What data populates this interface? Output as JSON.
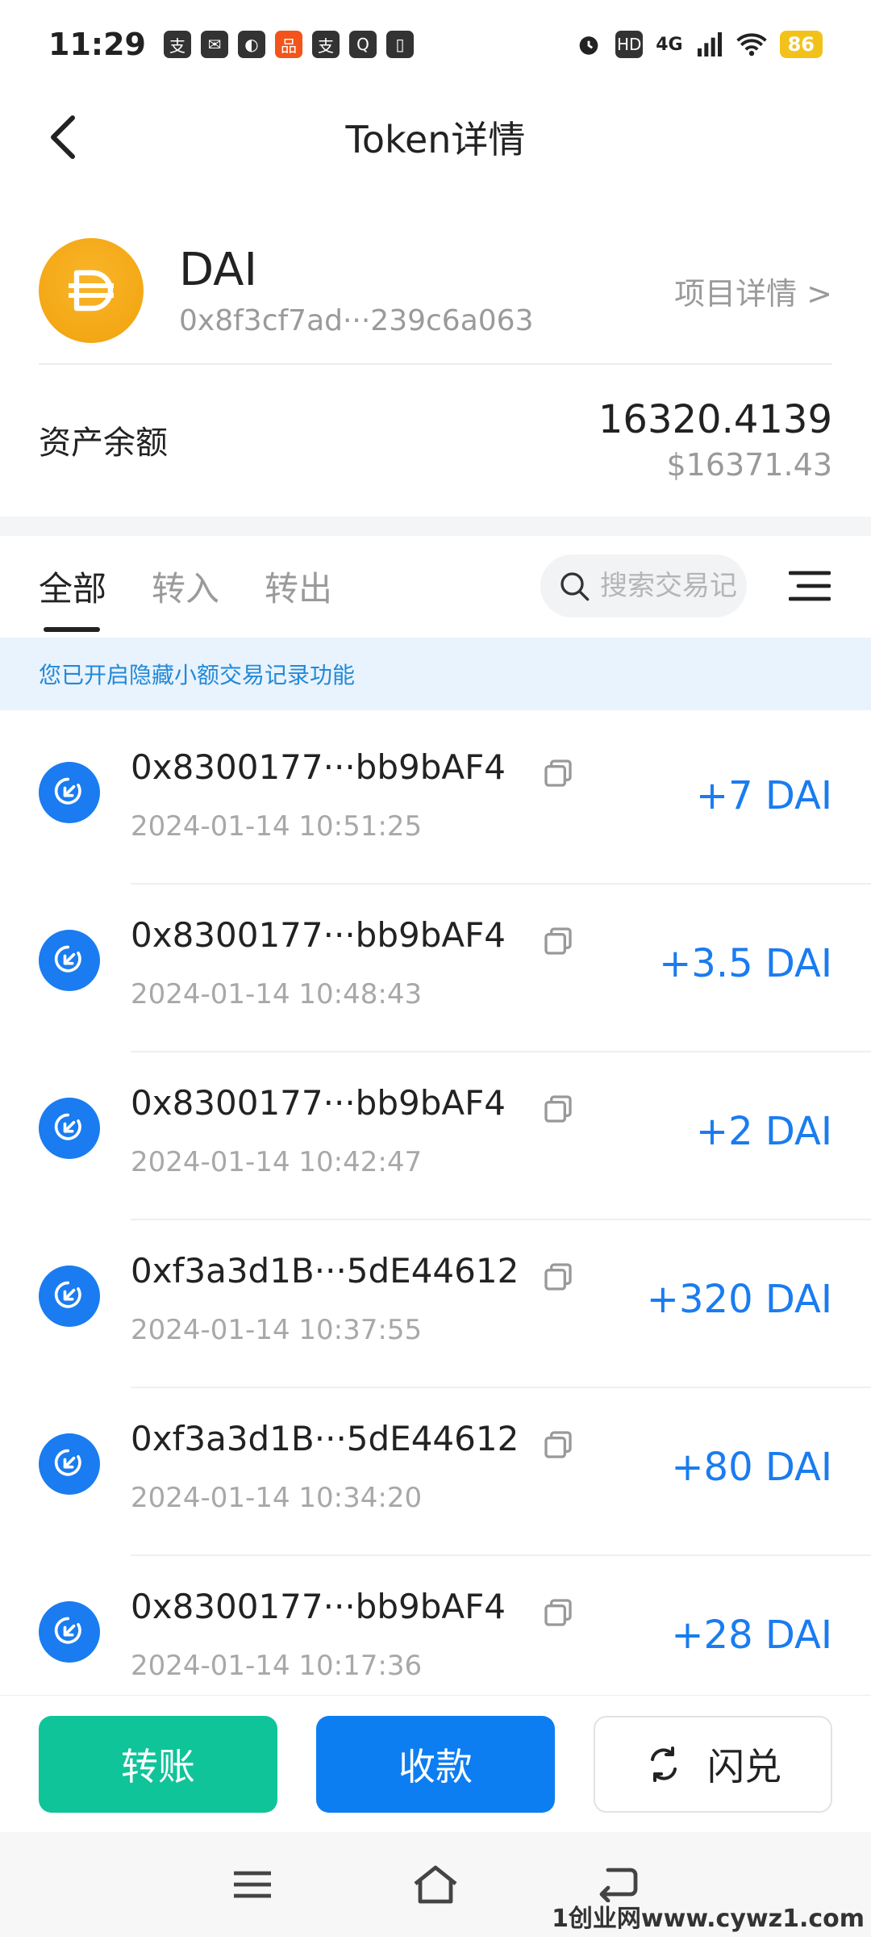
{
  "status_bar": {
    "time": "11:29",
    "network": "4G",
    "hd": "HD",
    "battery": "86"
  },
  "header": {
    "title": "Token详情"
  },
  "token": {
    "symbol": "DAI",
    "address": "0x8f3cf7ad···239c6a063",
    "project_link": "项目详情 >",
    "logo_color": "#f5ac1c"
  },
  "balance": {
    "label": "资产余额",
    "amount": "16320.4139",
    "usd": "$16371.43"
  },
  "tabs": [
    {
      "label": "全部"
    },
    {
      "label": "转入"
    },
    {
      "label": "转出"
    }
  ],
  "search": {
    "placeholder": "搜索交易记录"
  },
  "notice": "您已开启隐藏小额交易记录功能",
  "transactions": [
    {
      "address": "0x8300177···bb9bAF4",
      "time": "2024-01-14 10:51:25",
      "amount": "+7 DAI"
    },
    {
      "address": "0x8300177···bb9bAF4",
      "time": "2024-01-14 10:48:43",
      "amount": "+3.5 DAI"
    },
    {
      "address": "0x8300177···bb9bAF4",
      "time": "2024-01-14 10:42:47",
      "amount": "+2 DAI"
    },
    {
      "address": "0xf3a3d1B···5dE44612",
      "time": "2024-01-14 10:37:55",
      "amount": "+320 DAI"
    },
    {
      "address": "0xf3a3d1B···5dE44612",
      "time": "2024-01-14 10:34:20",
      "amount": "+80 DAI"
    },
    {
      "address": "0x8300177···bb9bAF4",
      "time": "2024-01-14 10:17:36",
      "amount": "+28 DAI"
    }
  ],
  "actions": {
    "transfer": "转账",
    "receive": "收款",
    "swap": "闪兑"
  },
  "colors": {
    "accent_blue": "#0c7ef2",
    "accent_green": "#10c49a",
    "amount_blue": "#1a7cf0"
  },
  "watermark": "1创业网www.cywz1.com"
}
